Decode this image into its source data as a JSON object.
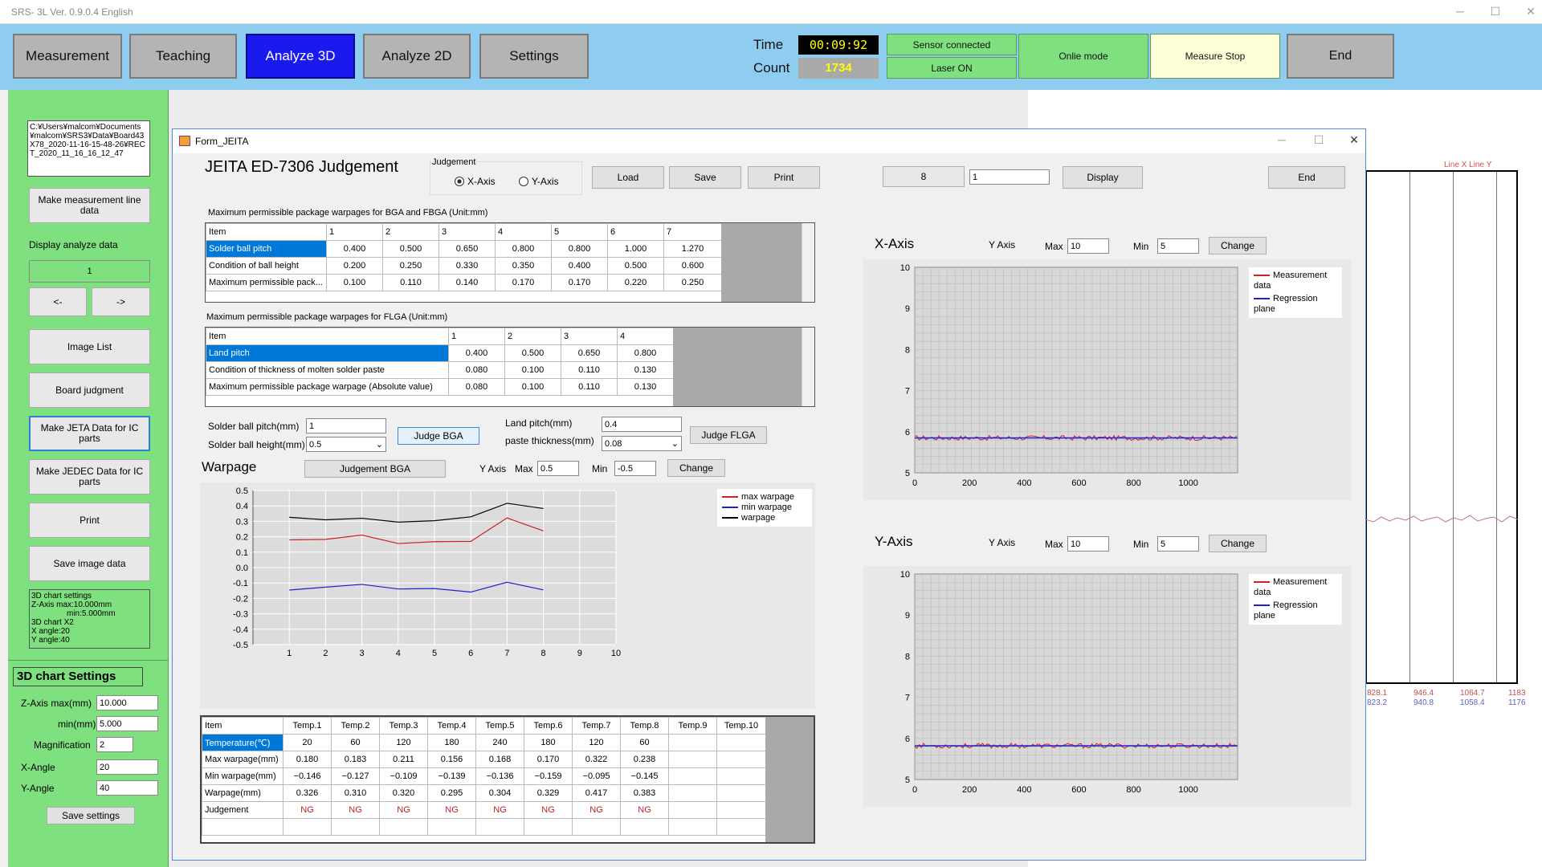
{
  "app": {
    "title": "SRS- 3L Ver. 0.9.0.4 English"
  },
  "nav": {
    "buttons": [
      "Measurement",
      "Teaching",
      "Analyze 3D",
      "Analyze 2D",
      "Settings"
    ]
  },
  "status": {
    "time_label": "Time",
    "time_value": "00:09:92",
    "count_label": "Count",
    "count_value": "1734",
    "sensor": "Sensor connected",
    "laser": "Laser ON",
    "mode": "Onlie mode",
    "measure": "Measure Stop",
    "end": "End"
  },
  "left": {
    "path": "C:¥Users¥malcom¥Documents¥malcom¥SRS3¥Data¥Board43X78_2020-11-16-15-48-26¥RECT_2020_11_16_16_12_47",
    "make_line": "Make measurement line data",
    "display_label": "Display analyze data",
    "display_value": "1",
    "prev": "<-",
    "next": "->",
    "image_list": "Image List",
    "board_judgment": "Board judgment",
    "make_jeta": "Make JETA Data for IC parts",
    "make_jedec": "Make JEDEC Data for IC parts",
    "print": "Print",
    "save_image": "Save image data",
    "chart_settings_text": [
      "3D chart settings",
      "Z-Axis max:10.000mm",
      "min:5.000mm",
      "3D chart X2",
      "X angle:20",
      "Y angle:40"
    ],
    "settings_title": "3D chart Settings",
    "zmax_label": "Z-Axis  max(mm)",
    "zmax": "10.000",
    "zmin_label": "min(mm)",
    "zmin": "5.000",
    "mag_label": "Magnification",
    "mag": "2",
    "xangle_label": "X-Angle",
    "xangle": "20",
    "yangle_label": "Y-Angle",
    "yangle": "40",
    "save_settings": "Save settings"
  },
  "form": {
    "title": "Form_JEITA",
    "heading": "JEITA ED-7306 Judgement",
    "judgement_label": "Judgement",
    "xaxis": "X-Axis",
    "yaxis": "Y-Axis",
    "load": "Load",
    "save": "Save",
    "print": "Print",
    "field1": "8",
    "field2": "1",
    "display": "Display",
    "end": "End",
    "bga_caption": "Maximum permissible package warpages for BGA and FBGA (Unit:mm)",
    "bga_header": [
      "Item",
      "1",
      "2",
      "3",
      "4",
      "5",
      "6",
      "7"
    ],
    "bga_rows": [
      [
        "Solder ball pitch",
        "0.400",
        "0.500",
        "0.650",
        "0.800",
        "0.800",
        "1.000",
        "1.270"
      ],
      [
        "Condition of ball height",
        "0.200",
        "0.250",
        "0.330",
        "0.350",
        "0.400",
        "0.500",
        "0.600"
      ],
      [
        "Maximum permissible pack...",
        "0.100",
        "0.110",
        "0.140",
        "0.170",
        "0.170",
        "0.220",
        "0.250"
      ]
    ],
    "flga_caption": "Maximum permissible package warpages for FLGA (Unit:mm)",
    "flga_header": [
      "Item",
      "1",
      "2",
      "3",
      "4"
    ],
    "flga_rows": [
      [
        "Land pitch",
        "0.400",
        "0.500",
        "0.650",
        "0.800"
      ],
      [
        "Condition of thickness of molten solder paste",
        "0.080",
        "0.100",
        "0.110",
        "0.130"
      ],
      [
        "Maximum permissible package warpage (Absolute value)",
        "0.080",
        "0.100",
        "0.110",
        "0.130"
      ]
    ],
    "ball_pitch_label": "Solder ball pitch(mm)",
    "ball_pitch": "1",
    "ball_height_label": "Solder ball height(mm)",
    "ball_height": "0.5",
    "judge_bga": "Judge BGA",
    "land_pitch_label": "Land pitch(mm)",
    "land_pitch": "0.4",
    "paste_label": "paste thickness(mm)",
    "paste": "0.08",
    "judge_flga": "Judge FLGA",
    "warpage_title": "Warpage",
    "judgement_bga": "Judgement BGA",
    "yaxis_label": "Y Axis",
    "max_label": "Max",
    "max": "0.5",
    "min_label": "Min",
    "min": "-0.5",
    "change": "Change",
    "temp_header": [
      "Item",
      "Temp.1",
      "Temp.2",
      "Temp.3",
      "Temp.4",
      "Temp.5",
      "Temp.6",
      "Temp.7",
      "Temp.8",
      "Temp.9",
      "Temp.10"
    ],
    "temp_rows": [
      [
        "Temperature(℃)",
        "20",
        "60",
        "120",
        "180",
        "240",
        "180",
        "120",
        "60",
        "",
        ""
      ],
      [
        "Max warpage(mm)",
        "0.180",
        "0.183",
        "0.211",
        "0.156",
        "0.168",
        "0.170",
        "0.322",
        "0.238",
        "",
        ""
      ],
      [
        "Min warpage(mm)",
        "−0.146",
        "−0.127",
        "−0.109",
        "−0.139",
        "−0.136",
        "−0.159",
        "−0.095",
        "−0.145",
        "",
        ""
      ],
      [
        "Warpage(mm)",
        "0.326",
        "0.310",
        "0.320",
        "0.295",
        "0.304",
        "0.329",
        "0.417",
        "0.383",
        "",
        ""
      ],
      [
        "Judgement",
        "NG",
        "NG",
        "NG",
        "NG",
        "NG",
        "NG",
        "NG",
        "NG",
        "",
        ""
      ]
    ],
    "xaxis_title": "X-Axis",
    "yaxis_title": "Y-Axis",
    "ax_label": "Y Axis",
    "ax_max_label": "Max",
    "ax_max": "10",
    "ax_min_label": "Min",
    "ax_min": "5",
    "ax_change": "Change",
    "legend_meas": "Measurement data",
    "legend_reg": "Regression plane"
  },
  "bg": {
    "legend": "Line X  Line Y",
    "r1": [
      "828.1",
      "946.4",
      "1064.7",
      "1183"
    ],
    "r2": [
      "823.2",
      "940.8",
      "1058.4",
      "1176"
    ]
  },
  "chart_data": [
    {
      "type": "line",
      "title": "",
      "xlabel": "",
      "ylabel": "",
      "x": [
        1,
        2,
        3,
        4,
        5,
        6,
        7,
        8
      ],
      "xlim": [
        0,
        10
      ],
      "ylim": [
        -0.5,
        0.5
      ],
      "xticks": [
        "1",
        "2",
        "3",
        "4",
        "5",
        "6",
        "7",
        "8",
        "9",
        "10"
      ],
      "yticks": [
        "0.5",
        "0.4",
        "0.3",
        "0.2",
        "0.1",
        "0.0",
        "-0.1",
        "-0.2",
        "-0.3",
        "-0.4",
        "-0.5"
      ],
      "series": [
        {
          "name": "max warpage",
          "color": "#d02020",
          "values": [
            0.18,
            0.183,
            0.211,
            0.156,
            0.168,
            0.17,
            0.322,
            0.238
          ]
        },
        {
          "name": "min warpage",
          "color": "#2020d0",
          "values": [
            -0.146,
            -0.127,
            -0.109,
            -0.139,
            -0.136,
            -0.159,
            -0.095,
            -0.145
          ]
        },
        {
          "name": "warpage",
          "color": "#000000",
          "values": [
            0.326,
            0.31,
            0.32,
            0.295,
            0.304,
            0.329,
            0.417,
            0.383
          ]
        }
      ]
    },
    {
      "type": "line",
      "title": "X-Axis",
      "xlim": [
        0,
        1180
      ],
      "ylim": [
        5,
        10
      ],
      "xticks": [
        "0",
        "200",
        "400",
        "600",
        "800",
        "1000"
      ],
      "yticks": [
        "10",
        "9",
        "8",
        "7",
        "6",
        "5"
      ],
      "series": [
        {
          "name": "Measurement data",
          "color": "#d02020",
          "level": 5.85
        },
        {
          "name": "Regression plane",
          "color": "#2020d0",
          "level": 5.85
        }
      ]
    },
    {
      "type": "line",
      "title": "Y-Axis",
      "xlim": [
        0,
        1180
      ],
      "ylim": [
        5,
        10
      ],
      "xticks": [
        "0",
        "200",
        "400",
        "600",
        "800",
        "1000"
      ],
      "yticks": [
        "10",
        "9",
        "8",
        "7",
        "6",
        "5"
      ],
      "series": [
        {
          "name": "Measurement data",
          "color": "#d02020",
          "level": 5.82
        },
        {
          "name": "Regression plane",
          "color": "#2020d0",
          "level": 5.82
        }
      ]
    }
  ]
}
